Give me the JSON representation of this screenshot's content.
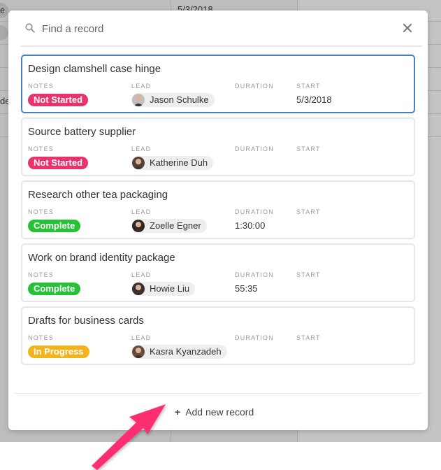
{
  "background": {
    "cells": [
      {
        "text": "e",
        "row": 0
      },
      {
        "text": "de",
        "row": 3
      },
      {
        "text": "5/3/2018",
        "row": 0
      }
    ]
  },
  "search": {
    "placeholder": "Find a record",
    "value": "",
    "icon": "search-icon",
    "close_icon": "close-icon"
  },
  "fields": {
    "notes": "NOTES",
    "lead": "LEAD",
    "duration": "DURATION",
    "start": "START"
  },
  "status_colors": {
    "Not Started": "#e9336b",
    "Complete": "#27c138",
    "In Progress": "#f2b31d"
  },
  "accent_color": "#4c7fbf",
  "annotation_arrow_color": "#ff2d6f",
  "records": [
    {
      "title": "Design clamshell case hinge",
      "notes": "Not Started",
      "lead": "Jason Schulke",
      "duration": "",
      "start": "5/3/2018",
      "selected": true
    },
    {
      "title": "Source battery supplier",
      "notes": "Not Started",
      "lead": "Katherine Duh",
      "duration": "",
      "start": "",
      "selected": false
    },
    {
      "title": "Research other tea packaging",
      "notes": "Complete",
      "lead": "Zoelle Egner",
      "duration": "1:30:00",
      "start": "",
      "selected": false
    },
    {
      "title": "Work on brand identity package",
      "notes": "Complete",
      "lead": "Howie Liu",
      "duration": "55:35",
      "start": "",
      "selected": false
    },
    {
      "title": "Drafts for business cards",
      "notes": "In Progress",
      "lead": "Kasra Kyanzadeh",
      "duration": "",
      "start": "",
      "selected": false
    }
  ],
  "footer": {
    "add_label": "Add new record",
    "add_icon": "plus-icon"
  }
}
